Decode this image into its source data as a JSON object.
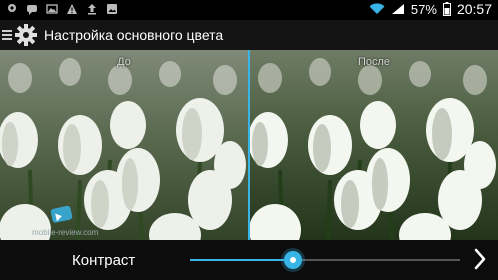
{
  "status_bar": {
    "battery_percent": "57%",
    "time": "20:57",
    "left_icons": [
      "location-icon",
      "chat-icon",
      "image-icon",
      "warning-icon",
      "upload-icon",
      "photo-icon"
    ],
    "right_icons": [
      "wifi-icon",
      "signal-icon",
      "battery-icon"
    ]
  },
  "app_bar": {
    "title": "Настройка основного цвета",
    "icon": "gear-icon"
  },
  "preview": {
    "before_label": "До",
    "after_label": "После"
  },
  "control": {
    "label": "Контраст",
    "value_fraction": 0.38,
    "accent_color": "#38b4e6"
  },
  "watermark": {
    "text": "mobile-review.com"
  }
}
